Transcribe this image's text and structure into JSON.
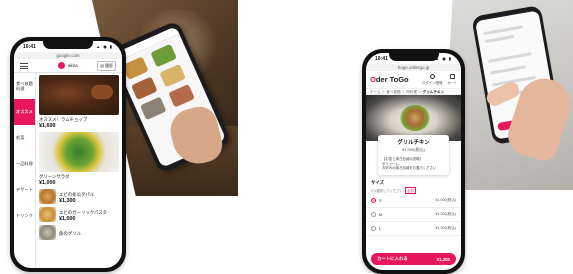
{
  "colors": {
    "accent": "#e6175c",
    "phone_frame": "#111111",
    "background": "#ffffff"
  },
  "left_phone": {
    "status_time": "10:41",
    "status_icons": "▲ ◉ ▮",
    "url": "google.com",
    "header": {
      "menu_icon": "hamburger-icon",
      "store_name": "akira",
      "history_label": "履歴"
    },
    "categories": [
      "食べ放題料理",
      "オススメ",
      "前菜",
      "一品料理",
      "デザート",
      "ドリンク"
    ],
    "active_category_index": 1,
    "featured_items": [
      {
        "name": "オススメ！ラムチョップ",
        "price": "¥1,600"
      },
      {
        "name": "グリーンサラダ",
        "price": "¥1,000"
      }
    ],
    "list_items": [
      {
        "name": "エビの冬瓜タパル",
        "price": "¥1,300"
      },
      {
        "name": "エビのガーリックパスタ",
        "price": "¥1,000"
      },
      {
        "name": "魚のグリル",
        "price": ""
      }
    ]
  },
  "right_phone": {
    "status_time": "10:41",
    "status_icons": "▲ ◉ ▮",
    "url": "hoge.ordergo.jp",
    "logo": {
      "prefix": "O",
      "suffix": "der ToGo"
    },
    "actions": [
      {
        "icon": "user-icon",
        "label": "ログイン/登録"
      },
      {
        "icon": "cart-icon",
        "label": "カート"
      }
    ],
    "breadcrumb": {
      "trail": "ホーム ＞ 食べ放題 ＞ 肉料理 ＞ ",
      "current": "グリルチキン"
    },
    "product": {
      "name": "グリルチキン",
      "price": "¥1,000(税込)",
      "description": "【お皿と焼き加減の説明】\nボリューム\nお好みの焼き加減をお選びください"
    },
    "size_section": {
      "title": "サイズ",
      "note": "1つ選択してください",
      "required_label": "必須",
      "options": [
        {
          "label": "S",
          "price": "¥1,000(税込)",
          "selected": true
        },
        {
          "label": "M",
          "price": "¥1,200(税込)",
          "selected": false
        },
        {
          "label": "L",
          "price": "¥1,300(税込)",
          "selected": false
        }
      ]
    },
    "cta": {
      "label": "カートに入れる",
      "price": "¥1,300"
    }
  }
}
